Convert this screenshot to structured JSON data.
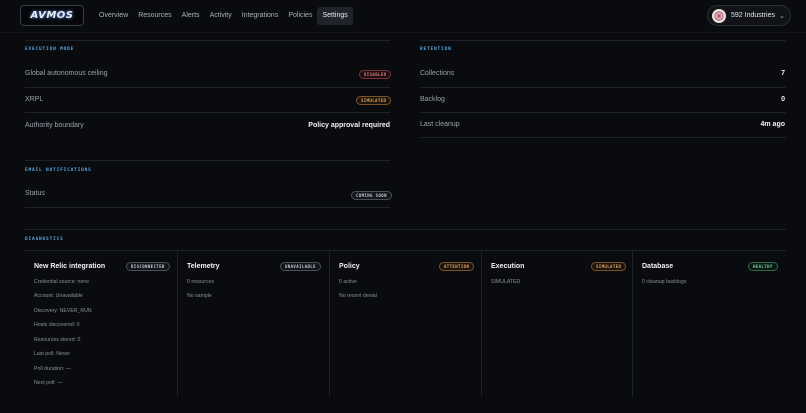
{
  "app": {
    "logo_text": "AVMOS"
  },
  "nav": {
    "items": [
      "Overview",
      "Resources",
      "Alerts",
      "Activity",
      "Integrations",
      "Policies",
      "Settings"
    ],
    "active": "Settings"
  },
  "org": {
    "name": "592 Industries"
  },
  "execution_mode": {
    "label": "EXECUTION MODE",
    "rows": [
      {
        "label": "Global autonomous ceiling",
        "badge": "DISABLED"
      },
      {
        "label": "XRPL",
        "badge": "SIMULATED"
      },
      {
        "label": "Authority boundary",
        "value": "Policy approval required"
      }
    ]
  },
  "retention": {
    "label": "RETENTION",
    "rows": [
      {
        "label": "Collections",
        "value": "7"
      },
      {
        "label": "Backlog",
        "value": "0"
      },
      {
        "label": "Last cleanup",
        "value": "4m ago"
      }
    ]
  },
  "email_notifications": {
    "label": "EMAIL NOTIFICATIONS",
    "rows": [
      {
        "label": "Status",
        "badge": "COMING SOON"
      }
    ]
  },
  "diagnostics": {
    "label": "DIAGNOSTICS",
    "cards": [
      {
        "title": "New Relic integration",
        "badge": "DISCONNECTED",
        "lines": [
          "Credential source: none",
          "Account: Unavailable",
          "Discovery: NEVER_RUN",
          "Hosts discovered: 0",
          "Resources stored: 0",
          "Last poll: Never",
          "Poll duration: —",
          "Next poll: —"
        ]
      },
      {
        "title": "Telemetry",
        "badge": "UNAVAILABLE",
        "lines": [
          "0 resources",
          "No sample"
        ]
      },
      {
        "title": "Policy",
        "badge": "ATTENTION",
        "lines": [
          "0 active",
          "No recent denial"
        ]
      },
      {
        "title": "Execution",
        "badge": "SIMULATED",
        "lines": [
          "SIMULATED"
        ]
      },
      {
        "title": "Database",
        "badge": "HEALTHY",
        "lines": [
          "0 cleanup backlogs"
        ]
      }
    ]
  }
}
